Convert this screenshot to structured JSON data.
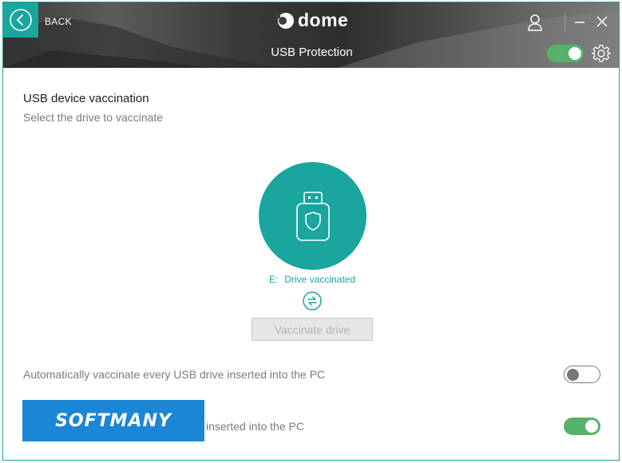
{
  "header": {
    "back_label": "BACK",
    "logo_text": "dome",
    "title": "USB Protection",
    "protection_enabled": true,
    "accent_color": "#1aa59f"
  },
  "icons": {
    "back": "chevron-left-circle",
    "user": "user-icon",
    "minimize": "minimize-icon",
    "close": "close-icon",
    "settings": "gear-icon",
    "usb": "usb-shield-icon",
    "refresh": "refresh-icon"
  },
  "main": {
    "title": "USB device vaccination",
    "subtitle": "Select the drive to vaccinate",
    "drive_letter": "E:",
    "drive_status": "Drive vaccinated",
    "vaccinate_button": "Vaccinate drive"
  },
  "options": [
    {
      "label": "Automatically vaccinate every USB drive inserted into the PC",
      "enabled": false
    },
    {
      "label": "inserted into the PC",
      "enabled": true
    }
  ],
  "watermark": {
    "text": "SOFTMANY"
  }
}
